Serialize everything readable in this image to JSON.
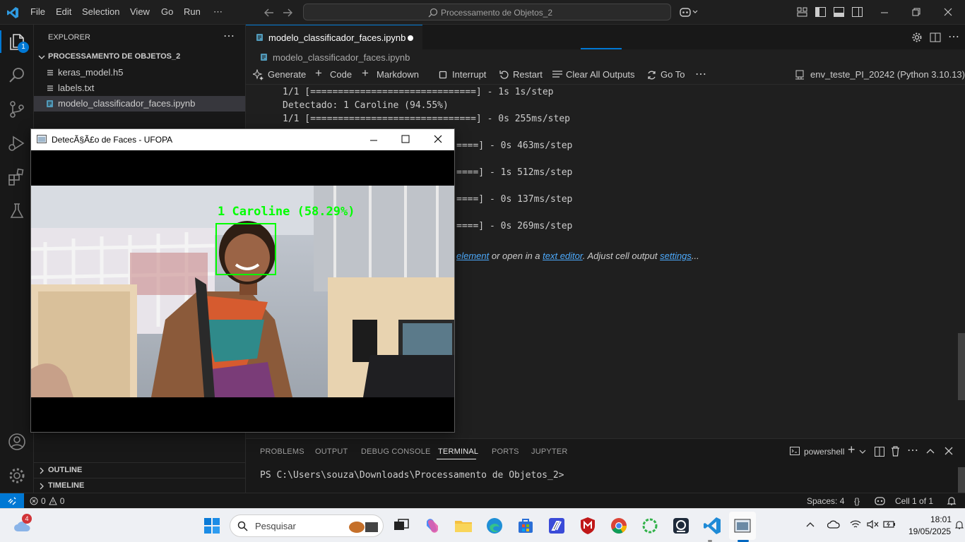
{
  "menu": [
    "File",
    "Edit",
    "Selection",
    "View",
    "Go",
    "Run",
    "⋯"
  ],
  "command_center": "Processamento de Objetos_2",
  "activity_badge": "1",
  "explorer": {
    "title": "EXPLORER",
    "folder": "PROCESSAMENTO DE OBJETOS_2",
    "files": [
      "keras_model.h5",
      "labels.txt",
      "modelo_classificador_faces.ipynb"
    ],
    "outline": "OUTLINE",
    "timeline": "TIMELINE"
  },
  "editor": {
    "tab_label": "modelo_classificador_faces.ipynb",
    "breadcrumb": "modelo_classificador_faces.ipynb",
    "toolbar": {
      "generate": "Generate",
      "code": "Code",
      "markdown": "Markdown",
      "interrupt": "Interrupt",
      "restart": "Restart",
      "clear_outputs": "Clear All Outputs",
      "goto": "Go To",
      "more": "⋯",
      "kernel": "env_teste_PI_20242 (Python 3.10.13)"
    },
    "output_lines": [
      "1/1 [==============================] - 1s 1s/step",
      "Detectado: 1 Caroline (94.55%)",
      "1/1 [==============================] - 0s 255ms/step",
      "====] - 0s 463ms/step",
      "====] - 1s 512ms/step",
      "====] - 0s 137ms/step",
      "====] - 0s 269ms/step"
    ],
    "truncation": {
      "link1": "element",
      "text1": " or open in a ",
      "link2": "text editor",
      "text2": ". Adjust cell output ",
      "link3": "settings",
      "text3": "..."
    }
  },
  "panel": {
    "tabs": [
      "PROBLEMS",
      "OUTPUT",
      "DEBUG CONSOLE",
      "TERMINAL",
      "PORTS",
      "JUPYTER"
    ],
    "active_tab": "TERMINAL",
    "shell": "powershell",
    "prompt": "PS C:\\Users\\souza\\Downloads\\Processamento de Objetos_2>"
  },
  "statusbar": {
    "errors": "0",
    "warnings": "0",
    "spaces": "Spaces: 4",
    "braces": "{}",
    "cell": "Cell 1 of 1"
  },
  "popup": {
    "title": "DetecÃ§Ã£o de Faces - UFOPA",
    "detection_label": "1 Caroline (58.29%)"
  },
  "taskbar": {
    "weather_badge": "4",
    "search_placeholder": "Pesquisar",
    "time": "18:01",
    "date": "19/05/2025"
  },
  "colors": {
    "accent": "#0078d4",
    "detect_green": "#00ff00",
    "link": "#4daafc"
  }
}
